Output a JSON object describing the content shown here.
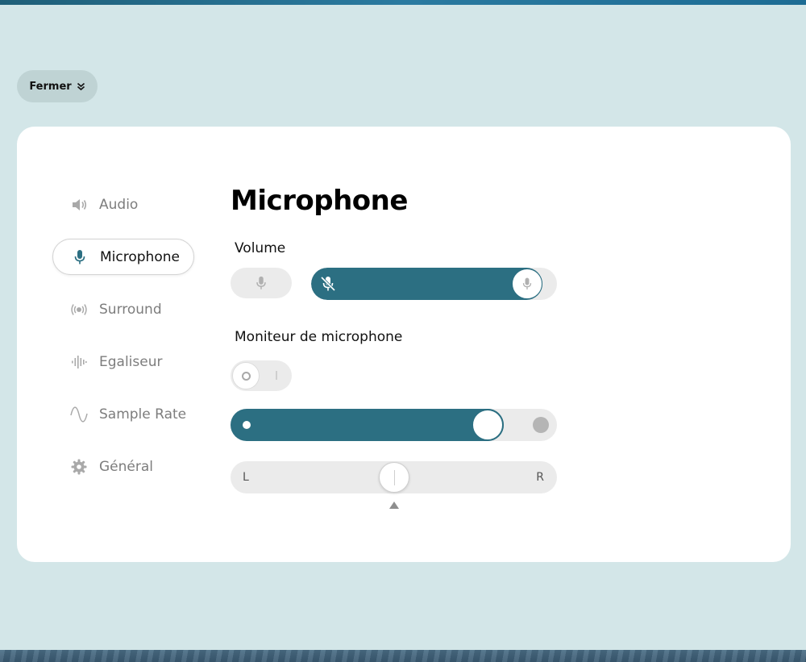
{
  "close_button": {
    "label": "Fermer",
    "icon": "double-chevron-down-icon"
  },
  "sidebar": {
    "items": [
      {
        "label": "Audio",
        "icon": "speaker-icon",
        "active": false
      },
      {
        "label": "Microphone",
        "icon": "microphone-icon",
        "active": true
      },
      {
        "label": "Surround",
        "icon": "broadcast-icon",
        "active": false
      },
      {
        "label": "Egaliseur",
        "icon": "waveform-icon",
        "active": false
      },
      {
        "label": "Sample Rate",
        "icon": "sine-wave-icon",
        "active": false
      },
      {
        "label": "Général",
        "icon": "gear-icon",
        "active": false
      }
    ]
  },
  "main": {
    "title": "Microphone",
    "volume": {
      "label": "Volume",
      "level": 0.94,
      "mute_icon": "microphone-muted-icon",
      "thumb_icon": "microphone-icon"
    },
    "monitor": {
      "label": "Moniteur de microphone",
      "toggle_on": false,
      "level": 0.82
    },
    "balance": {
      "left_label": "L",
      "right_label": "R",
      "value": 0.5
    }
  },
  "colors": {
    "accent": "#2c6f82",
    "background": "#d3e6e8",
    "panel": "#ffffff",
    "track": "#ebebeb"
  }
}
